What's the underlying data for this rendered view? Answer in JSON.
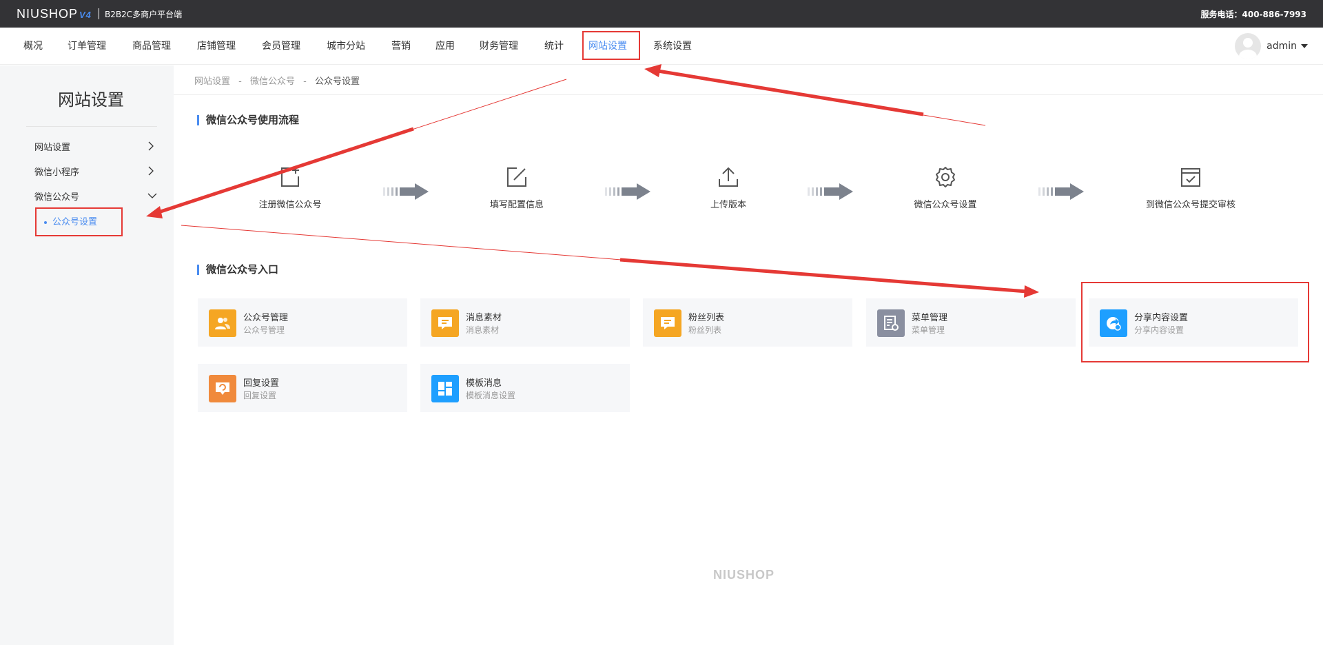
{
  "header": {
    "logo_text": "NIUSHOP",
    "logo_version": "V4",
    "platform_text": "B2B2C多商户平台端",
    "service_hotline": "服务电话：400-886-7993"
  },
  "nav": {
    "items": [
      {
        "label": "概况"
      },
      {
        "label": "订单管理"
      },
      {
        "label": "商品管理"
      },
      {
        "label": "店铺管理"
      },
      {
        "label": "会员管理"
      },
      {
        "label": "城市分站"
      },
      {
        "label": "营销"
      },
      {
        "label": "应用"
      },
      {
        "label": "财务管理"
      },
      {
        "label": "统计"
      },
      {
        "label": "网站设置",
        "active": true
      },
      {
        "label": "系统设置"
      }
    ],
    "user": "admin"
  },
  "sidebar": {
    "title": "网站设置",
    "items": [
      {
        "label": "网站设置",
        "expanded": false
      },
      {
        "label": "微信小程序",
        "expanded": false
      },
      {
        "label": "微信公众号",
        "expanded": true
      }
    ],
    "sub_item": "公众号设置"
  },
  "breadcrumb": [
    "网站设置",
    "微信公众号",
    "公众号设置"
  ],
  "breadcrumb_sep": "-",
  "flow": {
    "title": "微信公众号使用流程",
    "steps": [
      {
        "label": "注册微信公众号",
        "icon": "add-document-icon"
      },
      {
        "label": "填写配置信息",
        "icon": "edit-icon"
      },
      {
        "label": "上传版本",
        "icon": "upload-icon"
      },
      {
        "label": "微信公众号设置",
        "icon": "gear-icon"
      },
      {
        "label": "到微信公众号提交审核",
        "icon": "check-calendar-icon"
      }
    ]
  },
  "entry": {
    "title": "微信公众号入口",
    "cards": [
      {
        "title": "公众号管理",
        "subtitle": "公众号管理",
        "color": "#f5a623",
        "icon": "users-icon"
      },
      {
        "title": "消息素材",
        "subtitle": "消息素材",
        "color": "#f5a623",
        "icon": "message-icon"
      },
      {
        "title": "粉丝列表",
        "subtitle": "粉丝列表",
        "color": "#f5a623",
        "icon": "fans-list-icon"
      },
      {
        "title": "菜单管理",
        "subtitle": "菜单管理",
        "color": "#8a8fa0",
        "icon": "menu-icon"
      },
      {
        "title": "分享内容设置",
        "subtitle": "分享内容设置",
        "color": "#1e9fff",
        "icon": "share-icon"
      },
      {
        "title": "回复设置",
        "subtitle": "回复设置",
        "color": "#f08a3c",
        "icon": "reply-icon"
      },
      {
        "title": "模板消息",
        "subtitle": "模板消息设置",
        "color": "#1e9fff",
        "icon": "template-icon"
      }
    ]
  },
  "footer_logo": "NIUSHOP",
  "colors": {
    "accent": "#4a8cf0",
    "annotation": "#e53935",
    "topbar": "#333336"
  }
}
